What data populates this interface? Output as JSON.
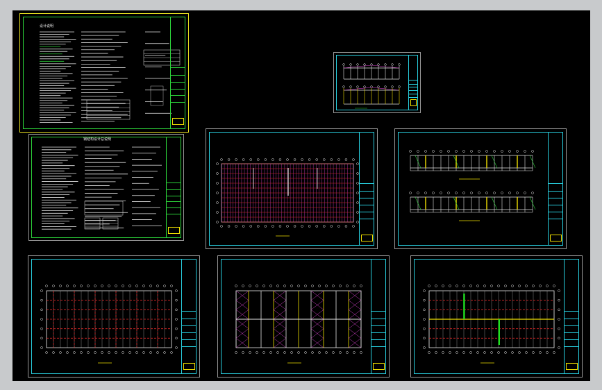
{
  "viewport": {
    "background": "#c8cacc",
    "canvas": "#000000"
  },
  "colors": {
    "frame_cyan": "#28d0e0",
    "frame_green": "#2cd43a",
    "frame_yellow": "#e8e020",
    "grid_white": "#e6e6e6",
    "grid_red": "#e02828",
    "grid_magenta": "#d040c8",
    "accent_green": "#20e020",
    "accent_yellow": "#f0e000"
  },
  "sheets": {
    "notes_1": {
      "title": "设计说明"
    },
    "notes_2": {
      "title": "钢结构设计总说明"
    },
    "elevations": {
      "title": ""
    },
    "roof_plan": {
      "title": ""
    },
    "column_elevations": {
      "title": ""
    },
    "foundation_plan": {
      "title": ""
    },
    "purlin_plan": {
      "title": ""
    },
    "bracing_plan": {
      "title": ""
    }
  }
}
